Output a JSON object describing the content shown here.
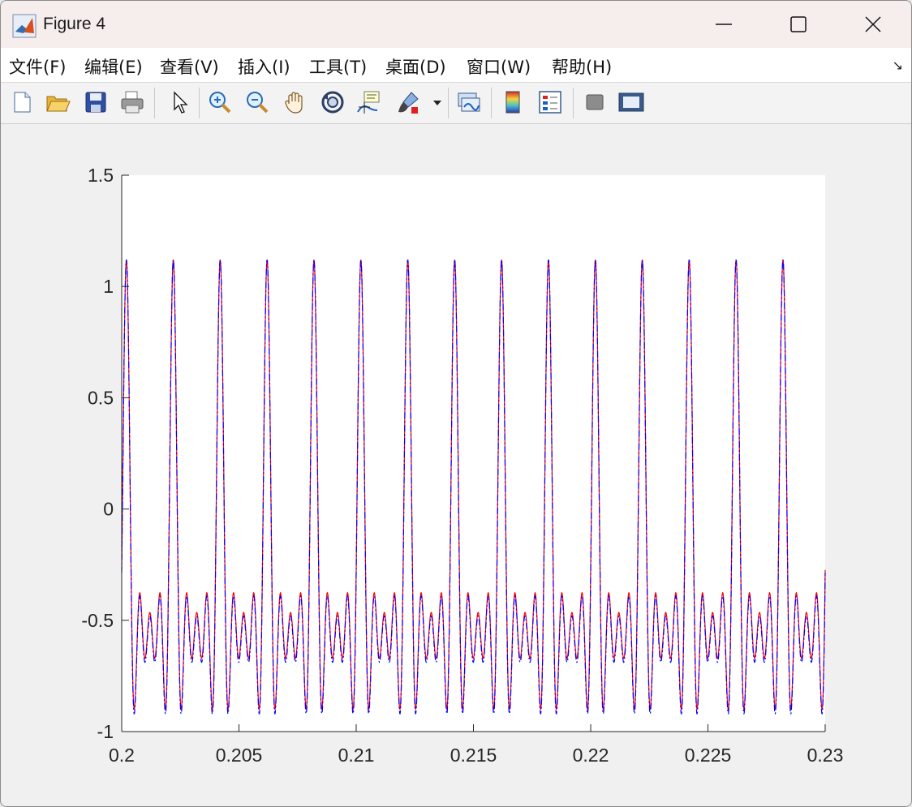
{
  "window": {
    "title": "Figure 4"
  },
  "menu": {
    "items": [
      {
        "label": "文件(F)"
      },
      {
        "label": "编辑(E)"
      },
      {
        "label": "查看(V)"
      },
      {
        "label": "插入(I)"
      },
      {
        "label": "工具(T)"
      },
      {
        "label": "桌面(D)"
      },
      {
        "label": "窗口(W)"
      },
      {
        "label": "帮助(H)"
      }
    ]
  },
  "toolbar": {
    "icons": [
      "new-figure-icon",
      "open-file-icon",
      "save-icon",
      "print-icon",
      "pointer-icon",
      "zoom-in-icon",
      "zoom-out-icon",
      "pan-hand-icon",
      "rotate-3d-icon",
      "data-cursor-icon",
      "brush-icon",
      "link-plot-icon",
      "colorbar-icon",
      "legend-icon",
      "hide-plot-tools-icon",
      "show-plot-tools-icon"
    ]
  },
  "colors": {
    "series_red": "#ff0000",
    "series_blue": "#0000ff"
  },
  "chart_data": {
    "type": "line",
    "title": "",
    "xlabel": "",
    "ylabel": "",
    "xlim": [
      0.2,
      0.23
    ],
    "ylim": [
      -1,
      1.5
    ],
    "xticks": [
      "0.2",
      "0.205",
      "0.21",
      "0.215",
      "0.22",
      "0.225",
      "0.23"
    ],
    "yticks": [
      "-1",
      "-0.5",
      "0",
      "0.5",
      "1",
      "1.5"
    ],
    "grid": false,
    "legend": "none",
    "series": [
      {
        "style": "solid",
        "color": "#ff0000",
        "peak_period": 0.002,
        "peak_phase": 0.0002,
        "max": 1.12,
        "min": -0.9
      },
      {
        "style": "dash-dot",
        "color": "#0000ff",
        "peak_period": 0.002,
        "peak_phase": 0.0002,
        "max": 1.12,
        "min": -0.92
      }
    ]
  }
}
